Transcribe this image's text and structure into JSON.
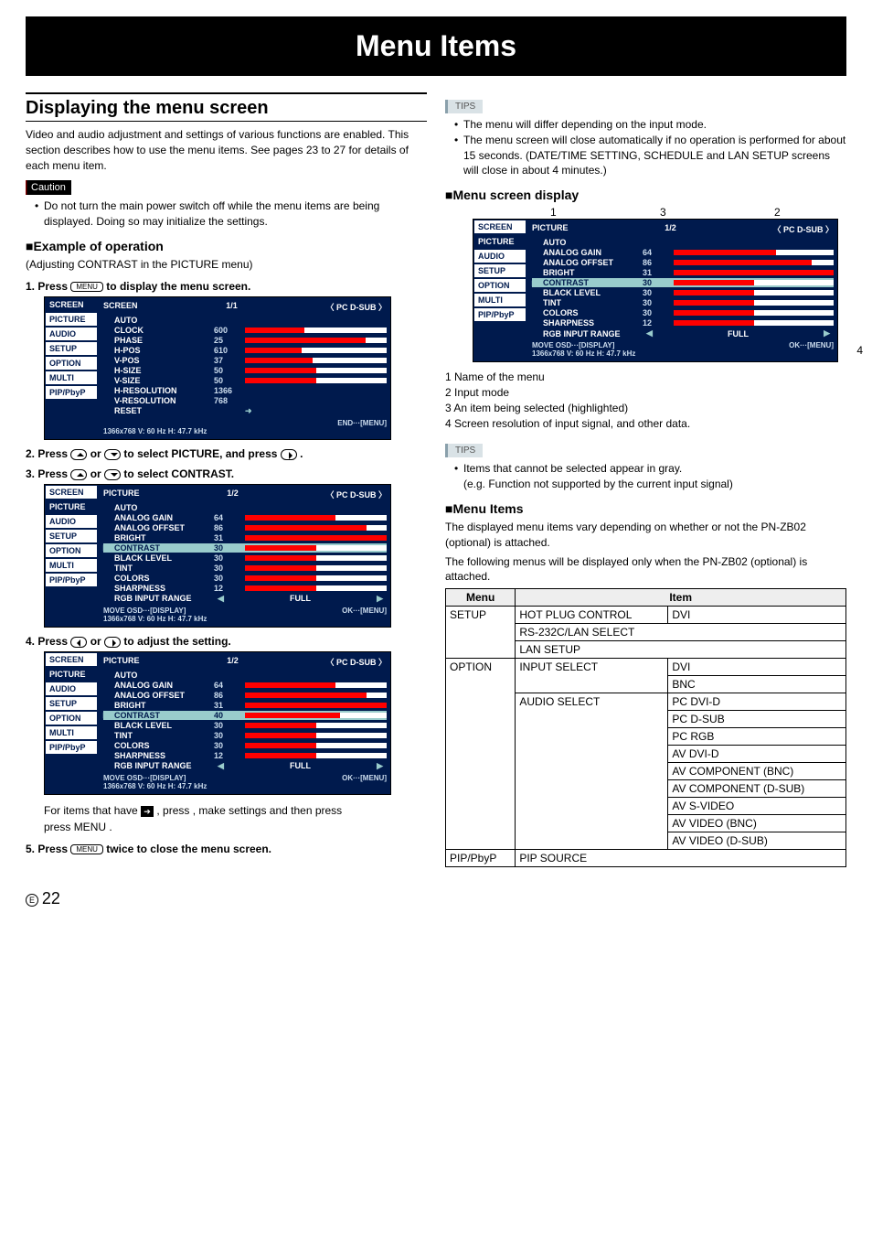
{
  "title_band": "Menu Items",
  "page_number": "22",
  "page_circ": "E",
  "left": {
    "h2": "Displaying the menu screen",
    "intro": "Video and audio adjustment and settings of various functions are enabled. This section describes how to use the menu items. See pages 23 to 27 for details of each menu item.",
    "caution_label": "Caution",
    "caution_text": "Do not turn the main power switch off while the menu items are being displayed. Doing so may initialize the settings.",
    "h3_example": "Example of operation",
    "example_sub": "(Adjusting CONTRAST in the PICTURE menu)",
    "steps": {
      "s1_a": "1.  Press ",
      "s1_menu": "MENU",
      "s1_b": " to display the menu screen.",
      "s2_a": "2.  Press ",
      "s2_b": " or ",
      "s2_c": " to select PICTURE, and press ",
      "s2_d": ".",
      "s3_a": "3.  Press ",
      "s3_b": " or ",
      "s3_c": " to select CONTRAST.",
      "s4_a": "4.  Press ",
      "s4_b": " or ",
      "s4_c": " to adjust the setting.",
      "note_a": "For items that have ",
      "note_icon": "➔",
      "note_b": " , press ",
      "note_c": ", make settings and then press ",
      "note_d": ".",
      "s5_a": "5.  Press ",
      "s5_b": " twice to close the menu screen."
    },
    "osd1": {
      "tabs": [
        "SCREEN",
        "PICTURE",
        "AUDIO",
        "SETUP",
        "OPTION",
        "MULTI",
        "PIP/PbyP"
      ],
      "active_tab": "SCREEN",
      "head": [
        "SCREEN",
        "1/1",
        "〈 PC D-SUB 〉"
      ],
      "items": [
        {
          "n": "AUTO"
        },
        {
          "n": "CLOCK",
          "v": "600",
          "f": 42
        },
        {
          "n": "PHASE",
          "v": "25",
          "f": 85
        },
        {
          "n": "H-POS",
          "v": "610",
          "f": 40
        },
        {
          "n": "V-POS",
          "v": "37",
          "f": 48
        },
        {
          "n": "H-SIZE",
          "v": "50",
          "f": 50
        },
        {
          "n": "V-SIZE",
          "v": "50",
          "f": 50
        },
        {
          "n": "H-RESOLUTION",
          "v": "1366"
        },
        {
          "n": "V-RESOLUTION",
          "v": "768"
        },
        {
          "n": "RESET",
          "arrow": true
        }
      ],
      "foot_right": "END···[MENU]",
      "foot2": "1366x768        V: 60 Hz   H: 47.7 kHz"
    },
    "osd2": {
      "tabs": [
        "SCREEN",
        "PICTURE",
        "AUDIO",
        "SETUP",
        "OPTION",
        "MULTI",
        "PIP/PbyP"
      ],
      "active_tab": "PICTURE",
      "head": [
        "PICTURE",
        "1/2",
        "〈 PC D-SUB 〉"
      ],
      "items": [
        {
          "n": "AUTO"
        },
        {
          "n": "ANALOG GAIN",
          "v": "64",
          "f": 64
        },
        {
          "n": "ANALOG OFFSET",
          "v": "86",
          "f": 86
        },
        {
          "n": "BRIGHT",
          "v": "31",
          "f": 100
        },
        {
          "n": "CONTRAST",
          "v": "30",
          "f": 50,
          "sel": true,
          "ptr": true
        },
        {
          "n": "BLACK LEVEL",
          "v": "30",
          "f": 50
        },
        {
          "n": "TINT",
          "v": "30",
          "f": 50
        },
        {
          "n": "COLORS",
          "v": "30",
          "f": 50
        },
        {
          "n": "SHARPNESS",
          "v": "12",
          "f": 50
        },
        {
          "n": "RGB INPUT RANGE",
          "full": "FULL"
        }
      ],
      "foot_left": "MOVE OSD···[DISPLAY]",
      "foot_right": "OK···[MENU]",
      "foot2": "1366x768        V: 60 Hz   H: 47.7 kHz"
    },
    "osd3": {
      "tabs": [
        "SCREEN",
        "PICTURE",
        "AUDIO",
        "SETUP",
        "OPTION",
        "MULTI",
        "PIP/PbyP"
      ],
      "active_tab": "PICTURE",
      "head": [
        "PICTURE",
        "1/2",
        "〈 PC D-SUB 〉"
      ],
      "items": [
        {
          "n": "AUTO"
        },
        {
          "n": "ANALOG GAIN",
          "v": "64",
          "f": 64
        },
        {
          "n": "ANALOG OFFSET",
          "v": "86",
          "f": 86
        },
        {
          "n": "BRIGHT",
          "v": "31",
          "f": 100
        },
        {
          "n": "CONTRAST",
          "v": "40",
          "f": 67,
          "sel": true,
          "ptr": true
        },
        {
          "n": "BLACK LEVEL",
          "v": "30",
          "f": 50
        },
        {
          "n": "TINT",
          "v": "30",
          "f": 50
        },
        {
          "n": "COLORS",
          "v": "30",
          "f": 50
        },
        {
          "n": "SHARPNESS",
          "v": "12",
          "f": 50
        },
        {
          "n": "RGB INPUT RANGE",
          "full": "FULL"
        }
      ],
      "foot_left": "MOVE OSD···[DISPLAY]",
      "foot_right": "OK···[MENU]",
      "foot2": "1366x768        V: 60 Hz   H: 47.7 kHz"
    }
  },
  "right": {
    "tips_label": "TIPS",
    "tips1": [
      "The menu will differ depending on the input mode.",
      "The menu screen will close automatically if no operation is performed for about 15 seconds. (DATE/TIME SETTING, SCHEDULE and LAN SETUP screens will close in about 4 minutes.)"
    ],
    "h3_disp": "Menu screen display",
    "callout_nums": [
      "1",
      "3",
      "2",
      "4"
    ],
    "anno_list": [
      "1  Name of the menu",
      "2  Input mode",
      "3  An item being selected (highlighted)",
      "4  Screen resolution of input signal, and other data."
    ],
    "tips2": [
      "Items that cannot be selected appear in gray.",
      "(e.g. Function not supported by the current input signal)"
    ],
    "h3_items": "Menu Items",
    "items_p1": "The displayed menu items vary depending on whether or not the PN-ZB02 (optional) is attached.",
    "items_p2": "The following menus will be displayed only when the PN-ZB02 (optional) is attached.",
    "table": {
      "headers": [
        "Menu",
        "Item"
      ],
      "rows": [
        {
          "menu": "SETUP",
          "item": "HOT PLUG CONTROL",
          "sub": "DVI",
          "mrow": 3,
          "irow": 1
        },
        {
          "item": "RS-232C/LAN SELECT",
          "span": 2
        },
        {
          "item": "LAN SETUP",
          "span": 2
        },
        {
          "menu": "OPTION",
          "item": "INPUT SELECT",
          "sub": "DVI",
          "mrow": 11,
          "irow": 2
        },
        {
          "sub": "BNC"
        },
        {
          "item": "AUDIO SELECT",
          "sub": "PC DVI-D",
          "irow": 9
        },
        {
          "sub": "PC D-SUB"
        },
        {
          "sub": "PC RGB"
        },
        {
          "sub": "AV DVI-D"
        },
        {
          "sub": "AV COMPONENT (BNC)"
        },
        {
          "sub": "AV COMPONENT (D-SUB)"
        },
        {
          "sub": "AV S-VIDEO"
        },
        {
          "sub": "AV VIDEO (BNC)"
        },
        {
          "sub": "AV VIDEO (D-SUB)"
        },
        {
          "menu": "PIP/PbyP",
          "item": "PIP SOURCE",
          "span": 2,
          "mrow": 1
        }
      ]
    }
  }
}
